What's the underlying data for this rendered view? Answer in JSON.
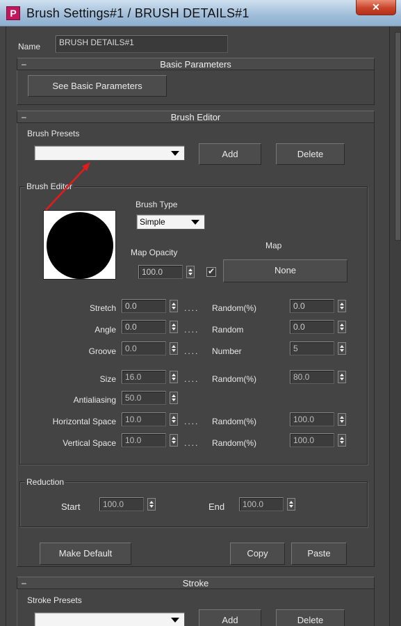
{
  "window": {
    "title": "Brush Settings#1 / BRUSH DETAILS#1",
    "icon_letter": "P",
    "close_glyph": "✕"
  },
  "name_row": {
    "label": "Name",
    "value": "BRUSH DETAILS#1"
  },
  "basic_parameters": {
    "title": "Basic Parameters",
    "collapse_glyph": "–",
    "button": "See Basic Parameters"
  },
  "brush_editor_rollout": {
    "title": "Brush Editor",
    "collapse_glyph": "–",
    "presets_label": "Brush Presets",
    "presets_value": "",
    "add_button": "Add",
    "delete_button": "Delete"
  },
  "brush_editor_group": {
    "title": "Brush Editor",
    "brush_type_label": "Brush Type",
    "brush_type_value": "Simple",
    "map_opacity_label": "Map Opacity",
    "map_opacity_value": "100.0",
    "map_checkbox_checked": "✔",
    "map_label": "Map",
    "map_button": "None",
    "dots": "....",
    "rows": {
      "stretch": {
        "label": "Stretch",
        "value": "0.0",
        "right_label": "Random(%)",
        "right_value": "0.0"
      },
      "angle": {
        "label": "Angle",
        "value": "0.0",
        "right_label": "Random",
        "right_value": "0.0"
      },
      "groove": {
        "label": "Groove",
        "value": "0.0",
        "right_label": "Number",
        "right_value": "5"
      },
      "size": {
        "label": "Size",
        "value": "16.0",
        "right_label": "Random(%)",
        "right_value": "80.0"
      },
      "antialiasing": {
        "label": "Antialiasing",
        "value": "50.0"
      },
      "hspace": {
        "label": "Horizontal Space",
        "value": "10.0",
        "right_label": "Random(%)",
        "right_value": "100.0"
      },
      "vspace": {
        "label": "Vertical Space",
        "value": "10.0",
        "right_label": "Random(%)",
        "right_value": "100.0"
      }
    }
  },
  "reduction": {
    "title": "Reduction",
    "start_label": "Start",
    "start_value": "100.0",
    "end_label": "End",
    "end_value": "100.0"
  },
  "bottom_buttons": {
    "make_default": "Make Default",
    "copy": "Copy",
    "paste": "Paste"
  },
  "stroke_rollout": {
    "title": "Stroke",
    "collapse_glyph": "–",
    "presets_label": "Stroke Presets",
    "presets_value": "",
    "add_button": "Add",
    "delete_button": "Delete"
  },
  "colors": {
    "background": "#444444",
    "annotation_arrow": "#e31b1b",
    "title_bar": "#9fbcd8",
    "close_button": "#c8432a"
  }
}
